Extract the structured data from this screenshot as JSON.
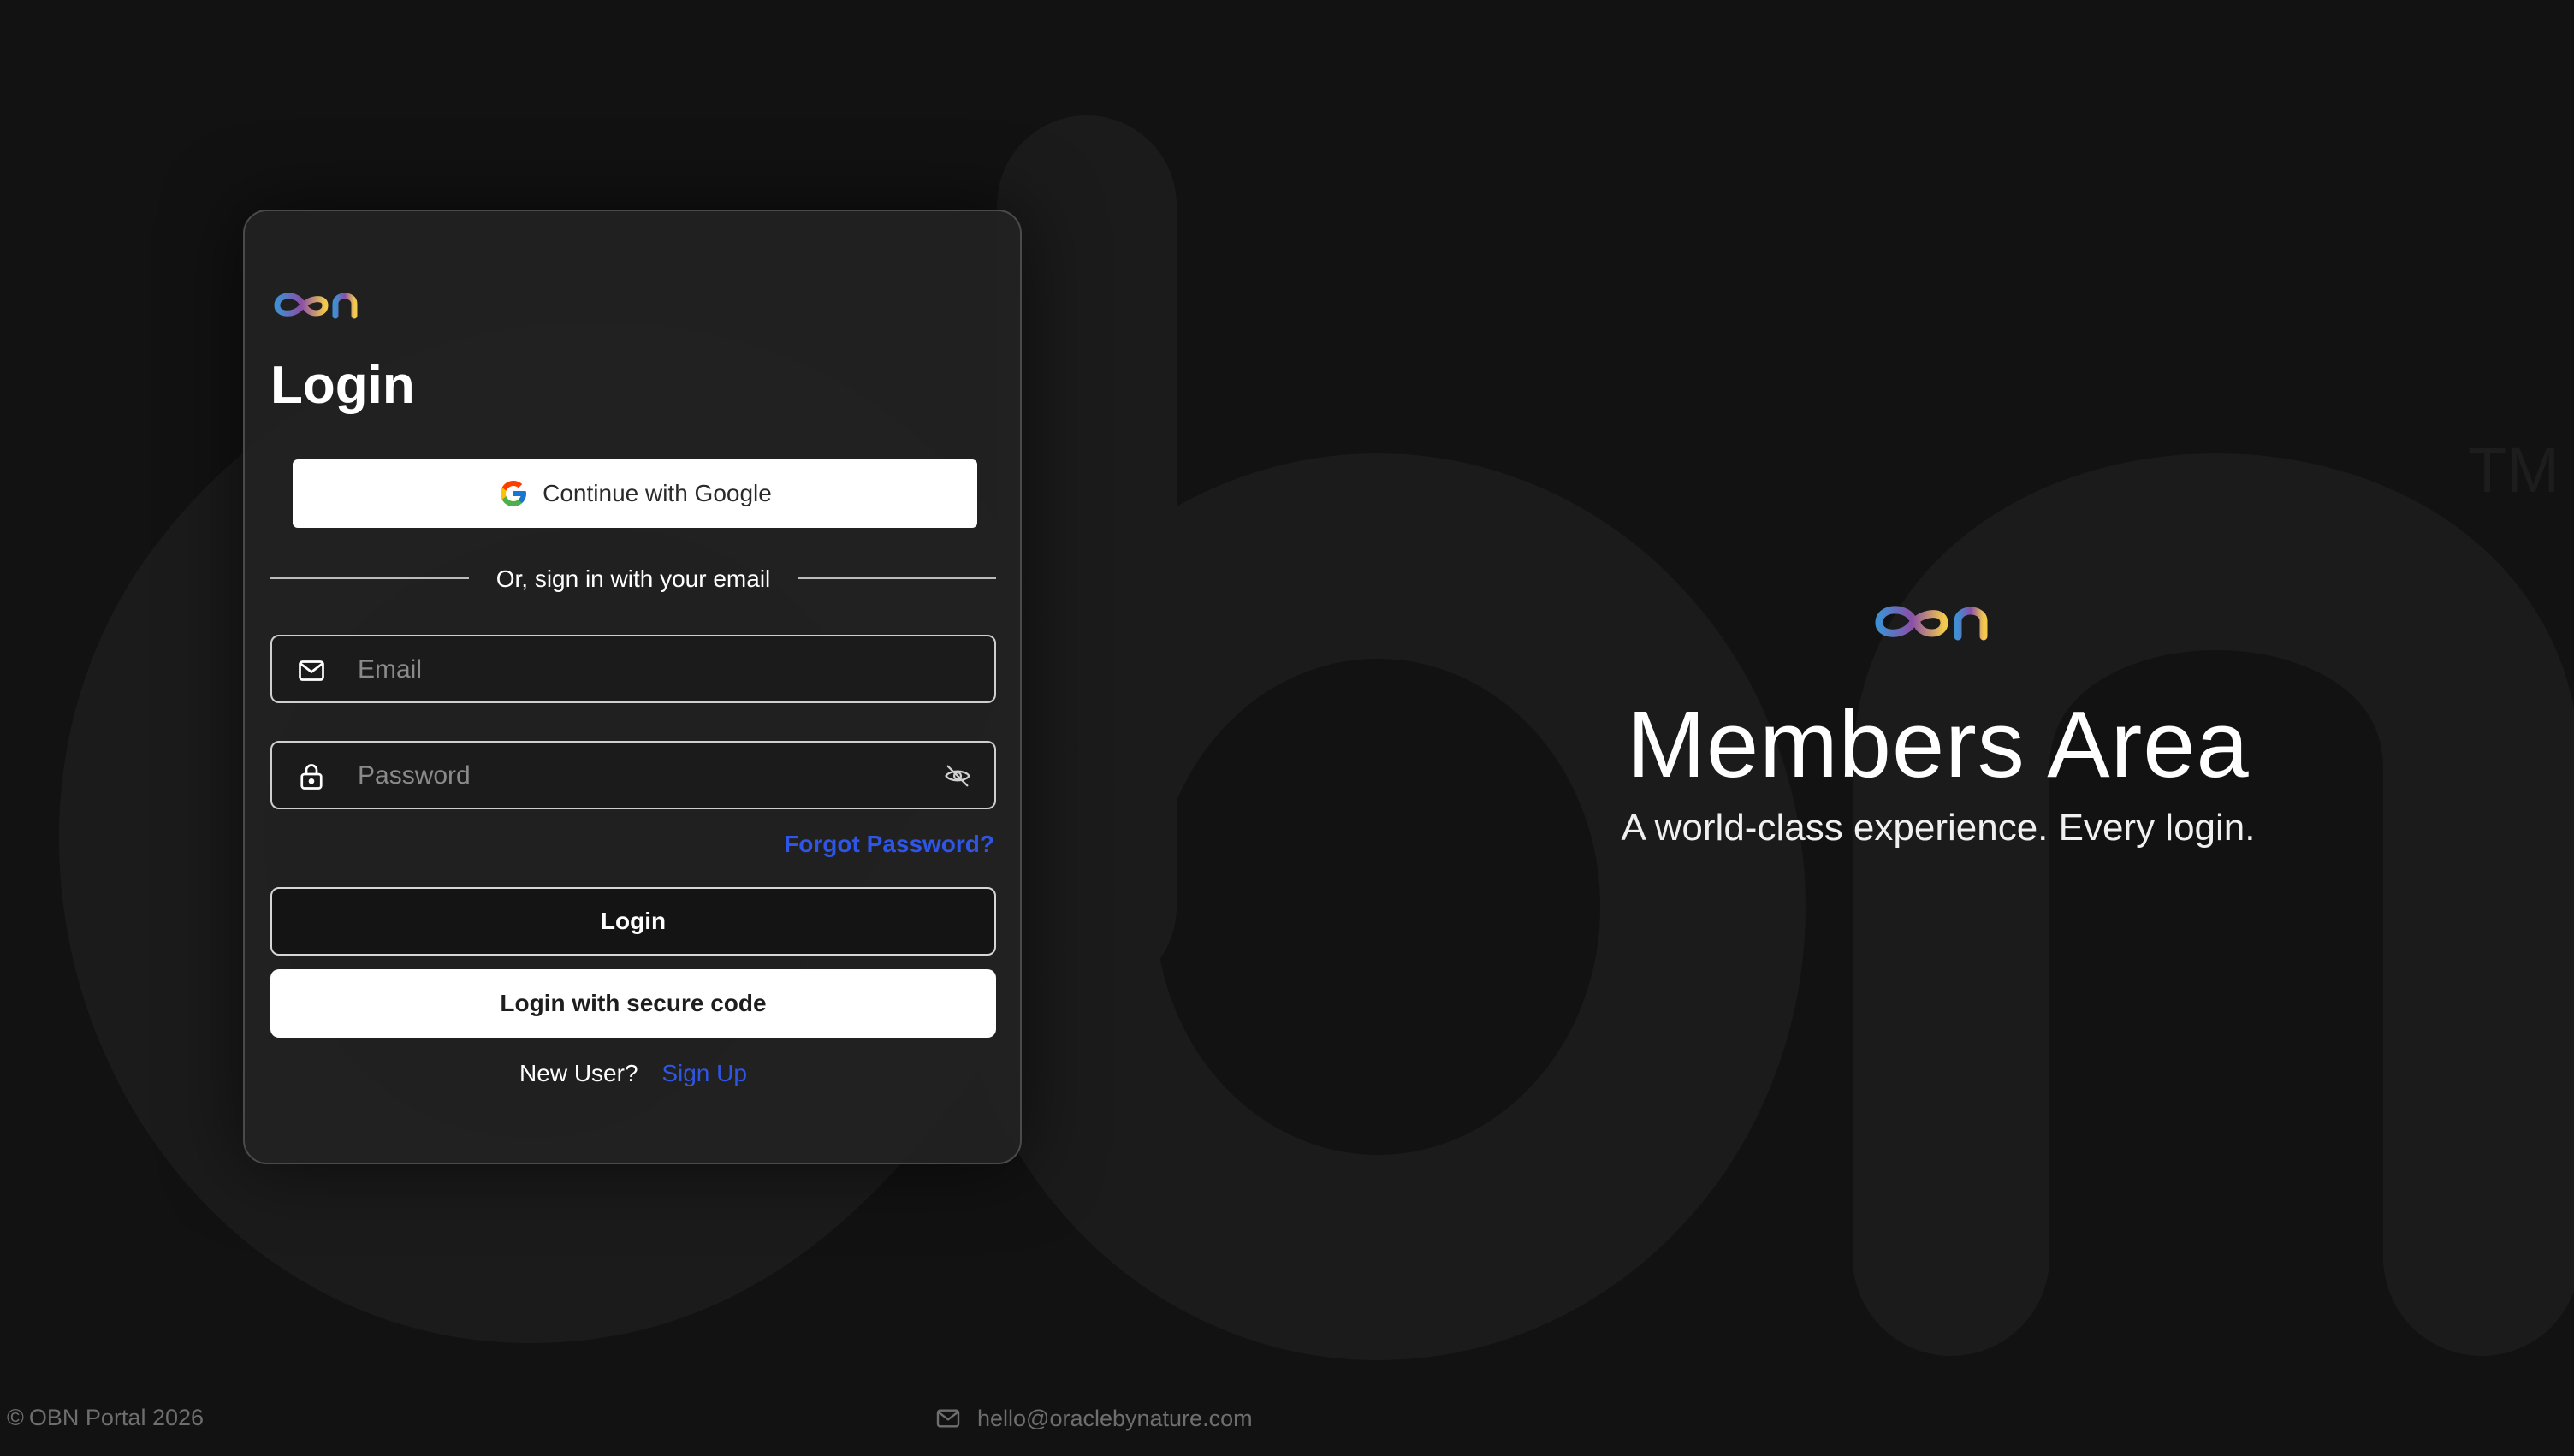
{
  "colors": {
    "background": "#121212",
    "card": "#222222",
    "link": "#2f55e6",
    "footer_text": "#6e6e6e"
  },
  "login_card": {
    "logo_icon": "obn-logo",
    "title": "Login",
    "google_button": {
      "label": "Continue with Google",
      "icon": "google-g-icon"
    },
    "divider_text": "Or, sign in with your email",
    "email_field": {
      "placeholder": "Email",
      "value": "",
      "icon": "mail-icon"
    },
    "password_field": {
      "placeholder": "Password",
      "value": "",
      "icon": "lock-icon",
      "toggle_icon": "eye-off-icon"
    },
    "forgot_password": "Forgot Password?",
    "login_button": "Login",
    "secure_code_button": "Login with secure code",
    "new_user_text": "New User?",
    "sign_up_link": "Sign Up"
  },
  "hero": {
    "logo_icon": "obn-logo",
    "title": "Members Area",
    "subtitle": "A world-class experience. Every login."
  },
  "background": {
    "watermark_icon": "obn-watermark",
    "trademark": "TM"
  },
  "footer": {
    "copyright_symbol": "©",
    "copyright": "OBN Portal 2026",
    "email_icon": "mail-icon",
    "email": "hello@oraclebynature.com"
  }
}
